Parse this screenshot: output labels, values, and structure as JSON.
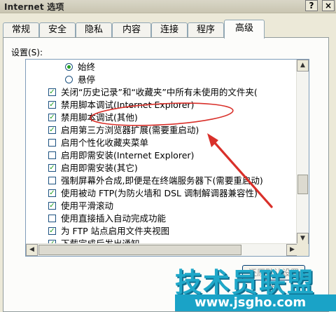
{
  "window": {
    "title": "Internet 选项",
    "help_label": "?",
    "close_label": "×"
  },
  "tabs": [
    {
      "label": "常规"
    },
    {
      "label": "安全"
    },
    {
      "label": "隐私"
    },
    {
      "label": "内容"
    },
    {
      "label": "连接"
    },
    {
      "label": "程序"
    },
    {
      "label": "高级",
      "active": true
    }
  ],
  "settings": {
    "label": "设置(S):",
    "items": [
      {
        "type": "radio",
        "checked": true,
        "indent": 1,
        "label": "始终"
      },
      {
        "type": "radio",
        "checked": false,
        "indent": 1,
        "label": "悬停"
      },
      {
        "type": "checkbox",
        "checked": true,
        "label": "关闭“历史记录”和“收藏夹”中所有未使用的文件夹("
      },
      {
        "type": "checkbox",
        "checked": true,
        "label": "禁用脚本调试(Internet Explorer)"
      },
      {
        "type": "checkbox",
        "checked": true,
        "label": "禁用脚本调试(其他)"
      },
      {
        "type": "checkbox",
        "checked": true,
        "label": "启用第三方浏览器扩展(需要重启动)"
      },
      {
        "type": "checkbox",
        "checked": false,
        "label": "启用个性化收藏夹菜单"
      },
      {
        "type": "checkbox",
        "checked": false,
        "label": "启用即需安装(Internet Explorer)"
      },
      {
        "type": "checkbox",
        "checked": true,
        "label": "启用即需安装(其它)"
      },
      {
        "type": "checkbox",
        "checked": false,
        "label": "强制屏幕外合成,即便是在终端服务器下(需要重启动)"
      },
      {
        "type": "checkbox",
        "checked": true,
        "label": "使用被动 FTP(为防火墙和 DSL 调制解调器兼容性)"
      },
      {
        "type": "checkbox",
        "checked": true,
        "label": "使用平滑滚动"
      },
      {
        "type": "checkbox",
        "checked": false,
        "label": "使用直接插入自动完成功能"
      },
      {
        "type": "checkbox",
        "checked": true,
        "label": "为 FTP 站点启用文件夹视图"
      },
      {
        "type": "checkbox",
        "checked": true,
        "label": "下载完成后发出通知"
      }
    ]
  },
  "buttons": {
    "restore_defaults": "还原默认设置(R)"
  },
  "watermark": {
    "title": "技术员联盟",
    "url": "www.jsgho.com"
  },
  "colors": {
    "annotation": "#d9302a",
    "watermark": "#1fa8c9",
    "check": "#21a121"
  },
  "icons": {
    "scroll_up": "triangle-up",
    "scroll_down": "triangle-down",
    "scroll_left": "triangle-left",
    "scroll_right": "triangle-right"
  }
}
